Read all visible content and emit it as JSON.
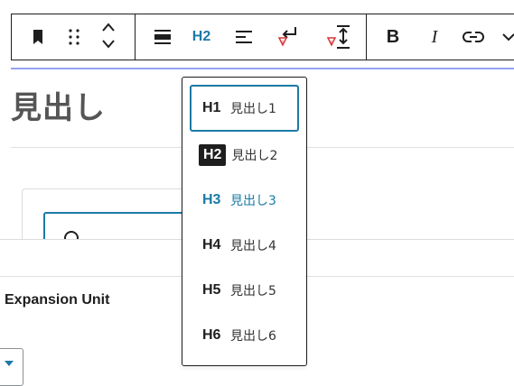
{
  "toolbar": {
    "heading_level_label": "H2",
    "bold_label": "B",
    "italic_label": "I"
  },
  "editor": {
    "heading_text": "見出し"
  },
  "panel": {
    "title": "Expansion Unit"
  },
  "heading_menu": {
    "items": [
      {
        "level": "H1",
        "label": "見出し1"
      },
      {
        "level": "H2",
        "label": "見出し2"
      },
      {
        "level": "H3",
        "label": "見出し3"
      },
      {
        "level": "H4",
        "label": "見出し4"
      },
      {
        "level": "H5",
        "label": "見出し5"
      },
      {
        "level": "H6",
        "label": "見出し6"
      }
    ],
    "active_level": "H2",
    "focused_level": "H1"
  },
  "colors": {
    "accent": "#1b7aa6",
    "border": "#1e1e1e",
    "heading_text": "#555555",
    "warning_icon": "#d63638"
  }
}
